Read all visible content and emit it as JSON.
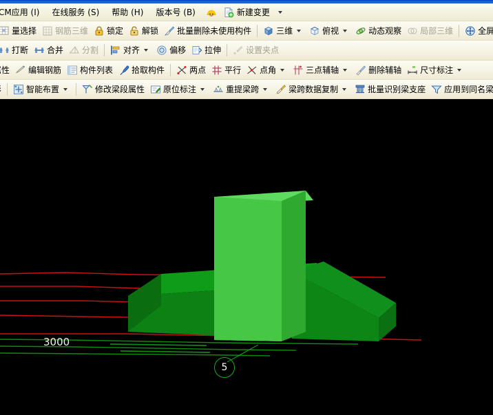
{
  "window": {
    "accent_color": "#0b3fc0",
    "toolbar_bg": "#f7f4e6",
    "viewport_bg": "#000000"
  },
  "menubar": {
    "items": [
      {
        "label": "CM应用 (I)",
        "name": "menu-bim-app"
      },
      {
        "label": "在线服务 (S)",
        "name": "menu-online-service"
      },
      {
        "label": "帮助 (H)",
        "name": "menu-help"
      },
      {
        "label": "版本号 (B)",
        "name": "menu-version"
      }
    ],
    "new_change": {
      "label": "新建变更",
      "icon": "new-document-icon"
    },
    "helmet_icon": "helmet-avatar-icon"
  },
  "toolbars": [
    {
      "name": "toolbar-row-selection",
      "items": [
        {
          "label": "量选择",
          "icon": "batch-select-icon",
          "disabled": false,
          "dropdown": false,
          "name": "batch-select-button"
        },
        {
          "label": "钢筋三维",
          "icon": "rebar-3d-icon",
          "disabled": true,
          "dropdown": false,
          "name": "rebar-3d-button"
        },
        {
          "label": "锁定",
          "icon": "lock-icon",
          "disabled": false,
          "dropdown": false,
          "name": "lock-button"
        },
        {
          "label": "解锁",
          "icon": "unlock-icon",
          "disabled": false,
          "dropdown": false,
          "name": "unlock-button"
        },
        {
          "label": "批量删除未使用构件",
          "icon": "brush-icon",
          "disabled": false,
          "dropdown": false,
          "name": "batch-delete-unused-button"
        },
        {
          "separator": true
        },
        {
          "label": "三维",
          "icon": "cube-3d-icon",
          "disabled": false,
          "dropdown": true,
          "name": "view-3d-button"
        },
        {
          "label": "俯视",
          "icon": "top-view-icon",
          "disabled": false,
          "dropdown": true,
          "name": "top-view-button"
        },
        {
          "label": "动态观察",
          "icon": "orbit-icon",
          "disabled": false,
          "dropdown": false,
          "name": "dynamic-observe-button"
        },
        {
          "label": "局部三维",
          "icon": "local-3d-icon",
          "disabled": true,
          "dropdown": false,
          "name": "local-3d-button"
        },
        {
          "separator": true
        },
        {
          "label": "全屏",
          "icon": "fullscreen-icon",
          "disabled": false,
          "dropdown": false,
          "name": "fullscreen-button"
        },
        {
          "label": "",
          "icon": "zoom-icon",
          "disabled": false,
          "dropdown": false,
          "name": "zoom-button"
        }
      ]
    },
    {
      "name": "toolbar-row-edit",
      "items": [
        {
          "label": "打断",
          "icon": "break-icon",
          "disabled": false,
          "dropdown": false,
          "name": "break-button"
        },
        {
          "label": "合并",
          "icon": "merge-icon",
          "disabled": false,
          "dropdown": false,
          "name": "merge-button"
        },
        {
          "label": "分割",
          "icon": "split-icon",
          "disabled": true,
          "dropdown": false,
          "name": "split-button"
        },
        {
          "separator": true
        },
        {
          "label": "对齐",
          "icon": "align-icon",
          "disabled": false,
          "dropdown": true,
          "name": "align-button"
        },
        {
          "label": "偏移",
          "icon": "offset-icon",
          "disabled": false,
          "dropdown": false,
          "name": "offset-button"
        },
        {
          "label": "拉伸",
          "icon": "stretch-icon",
          "disabled": false,
          "dropdown": false,
          "name": "stretch-button"
        },
        {
          "separator": true
        },
        {
          "label": "设置夹点",
          "icon": "grip-point-icon",
          "disabled": true,
          "dropdown": false,
          "name": "set-grip-point-button"
        }
      ]
    },
    {
      "name": "toolbar-row-properties",
      "items": [
        {
          "label": "属性",
          "icon": "properties-icon",
          "disabled": false,
          "dropdown": false,
          "name": "properties-button"
        },
        {
          "label": "编辑钢筋",
          "icon": "edit-rebar-icon",
          "disabled": false,
          "dropdown": false,
          "name": "edit-rebar-button"
        },
        {
          "label": "构件列表",
          "icon": "component-list-icon",
          "disabled": false,
          "dropdown": false,
          "name": "component-list-button"
        },
        {
          "label": "拾取构件",
          "icon": "pick-component-icon",
          "disabled": false,
          "dropdown": false,
          "name": "pick-component-button"
        },
        {
          "separator": true
        },
        {
          "label": "两点",
          "icon": "two-point-icon",
          "disabled": false,
          "dropdown": false,
          "name": "two-point-button"
        },
        {
          "label": "平行",
          "icon": "parallel-icon",
          "disabled": false,
          "dropdown": false,
          "name": "parallel-button"
        },
        {
          "label": "点角",
          "icon": "point-angle-icon",
          "disabled": false,
          "dropdown": true,
          "name": "point-angle-button"
        },
        {
          "label": "三点辅轴",
          "icon": "three-point-axis-icon",
          "disabled": false,
          "dropdown": true,
          "name": "three-point-axis-button"
        },
        {
          "label": "删除辅轴",
          "icon": "delete-axis-icon",
          "disabled": false,
          "dropdown": false,
          "name": "delete-axis-button"
        },
        {
          "label": "尺寸标注",
          "icon": "dimension-icon",
          "disabled": false,
          "dropdown": true,
          "name": "dimension-button"
        }
      ]
    },
    {
      "name": "toolbar-row-beam",
      "items": [
        {
          "label": "影",
          "icon": "shadow-icon",
          "disabled": false,
          "dropdown": false,
          "name": "shadow-button"
        },
        {
          "separator": true
        },
        {
          "label": "智能布置",
          "icon": "smart-layout-icon",
          "disabled": false,
          "dropdown": true,
          "name": "smart-layout-button"
        },
        {
          "separator": true
        },
        {
          "label": "修改梁段属性",
          "icon": "modify-beam-segment-icon",
          "disabled": false,
          "dropdown": false,
          "name": "modify-beam-segment-button"
        },
        {
          "label": "原位标注",
          "icon": "in-place-annotation-icon",
          "disabled": false,
          "dropdown": true,
          "name": "in-place-annotation-button"
        },
        {
          "label": "重提梁跨",
          "icon": "re-extract-span-icon",
          "disabled": false,
          "dropdown": true,
          "name": "re-extract-span-button"
        },
        {
          "label": "梁跨数据复制",
          "icon": "copy-span-data-icon",
          "disabled": false,
          "dropdown": true,
          "name": "copy-span-data-button"
        },
        {
          "label": "批量识别梁支座",
          "icon": "batch-identify-support-icon",
          "disabled": false,
          "dropdown": false,
          "name": "batch-identify-support-button"
        },
        {
          "label": "应用到同名梁",
          "icon": "apply-same-name-icon",
          "disabled": false,
          "dropdown": false,
          "name": "apply-to-same-name-beam-button"
        },
        {
          "label": "",
          "icon": "filter-icon",
          "disabled": false,
          "dropdown": false,
          "name": "filter-button"
        }
      ]
    }
  ],
  "viewport": {
    "name": "3d-model-viewport",
    "background": "#000000",
    "dimension_label": {
      "text": "3000",
      "color": "#f2f2f2"
    },
    "axis_bubble": {
      "text": "5",
      "stroke": "#1faa1f",
      "text_color": "#ffffff"
    },
    "grid_lines_color_red": "#cc1111",
    "grid_lines_color_green": "#118811",
    "model": {
      "column_color_light": "#4ec94e",
      "column_color_top": "#63e063",
      "column_color_side": "#3aad3a",
      "beam_color": "#0b8a17",
      "beam_color_dark": "#0a7a14",
      "beam_color_side": "#096b12"
    }
  }
}
